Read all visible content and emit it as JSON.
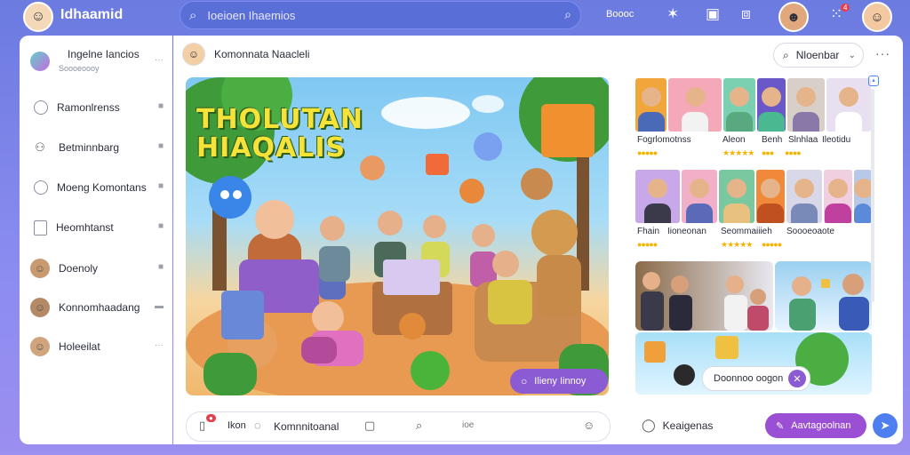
{
  "topbar": {
    "app_title": "Idhaamid",
    "search_placeholder": "Ioeioen Ihaemios",
    "link_text": "Boooc",
    "notification_count": "4"
  },
  "sidebar": {
    "items": [
      {
        "label": "Ingelne Iancios",
        "sub": "Soooeoooy",
        "trail": "···",
        "icon": "avatar-icon"
      },
      {
        "label": "Ramonlrenss",
        "trail": "■",
        "icon": "chat-icon"
      },
      {
        "label": "Betminnbarg",
        "trail": "■",
        "icon": "people-icon"
      },
      {
        "label": "Moeng Komontans",
        "trail": "■",
        "icon": "chat-icon"
      },
      {
        "label": "Heomhtanst",
        "trail": "■",
        "icon": "document-icon"
      },
      {
        "label": "Doenoly",
        "trail": "■",
        "icon": "avatar-icon"
      },
      {
        "label": "Konnomhaadang",
        "trail": "▬",
        "icon": "avatar-icon"
      },
      {
        "label": "Holeeilat",
        "trail": "···",
        "icon": "avatar-icon"
      }
    ]
  },
  "channel": {
    "title": "Komonnata Naacleli",
    "members_label": "Nloenbar"
  },
  "hero": {
    "title_line1": "THOLUTAN",
    "title_line2": "HIAQALIS",
    "button_label": "Ilieny Iinnoy"
  },
  "gallery": {
    "row1_captions": [
      "Fogrlomotnss",
      "Aleon",
      "Benh",
      "Slnhlaa",
      "Ileotidu"
    ],
    "row2_captions": [
      "Fhain",
      "Iioneonan",
      "Seommaiiieh",
      "Soooeoaote"
    ],
    "button_label": "Doonnoo oogon"
  },
  "compose": {
    "tab_label": "Ikon",
    "input_text": "Komnnitoanal",
    "emoji_label": "ioe"
  },
  "actions": {
    "react_label": "Keaigenas",
    "cta_label": "Aavtagoolnan"
  },
  "colors": {
    "accent": "#8b5bd4",
    "brand": "#6b7be0",
    "star": "#f4b400"
  }
}
